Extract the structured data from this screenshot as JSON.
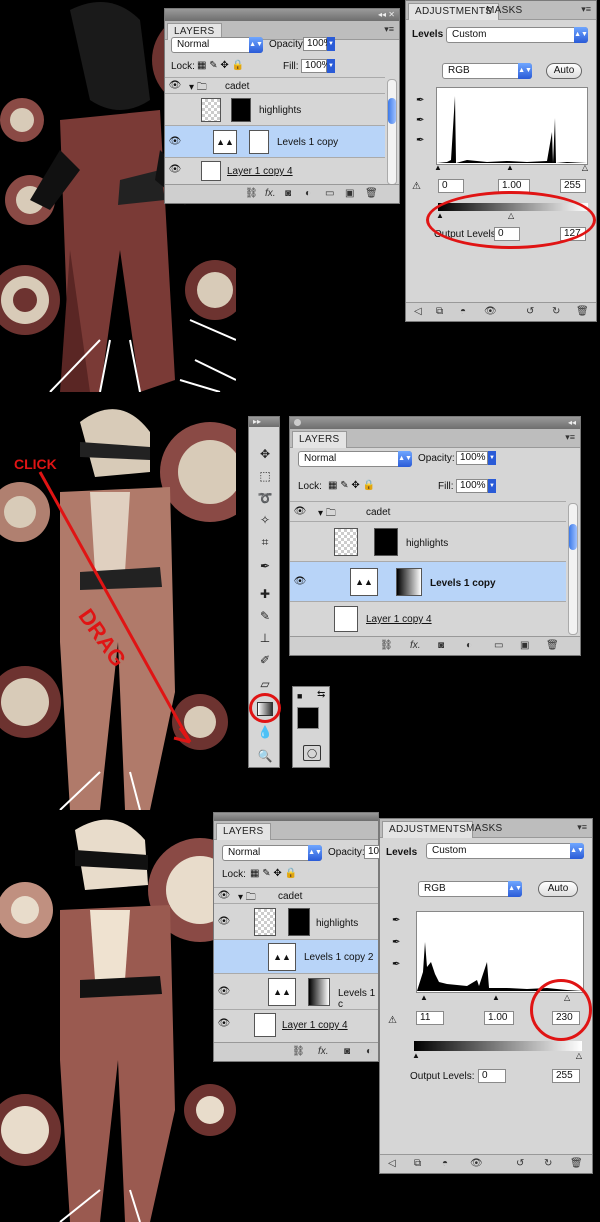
{
  "panel1": {
    "layers": {
      "tab": "LAYERS",
      "blend_mode": "Normal",
      "opacity_label": "Opacity:",
      "opacity": "100%",
      "lock_label": "Lock:",
      "fill_label": "Fill:",
      "fill": "100%",
      "items": [
        {
          "name": "cadet"
        },
        {
          "name": "highlights"
        },
        {
          "name": "Levels 1 copy"
        },
        {
          "name": "Layer 1 copy 4"
        }
      ]
    },
    "adjustments": {
      "tab1": "ADJUSTMENTS",
      "tab2": "MASKS",
      "title": "Levels",
      "preset": "Custom",
      "channel": "RGB",
      "auto": "Auto",
      "input_black": "0",
      "input_gamma": "1.00",
      "input_white": "255",
      "output_label": "Output Levels:",
      "output_black": "0",
      "output_white": "127"
    }
  },
  "panel2": {
    "annotations": {
      "click": "CLICK",
      "drag": "DRAG"
    },
    "layers": {
      "tab": "LAYERS",
      "blend_mode": "Normal",
      "opacity_label": "Opacity:",
      "opacity": "100%",
      "lock_label": "Lock:",
      "fill_label": "Fill:",
      "fill": "100%",
      "items": [
        {
          "name": "cadet"
        },
        {
          "name": "highlights"
        },
        {
          "name": "Levels 1 copy"
        },
        {
          "name": "Layer 1 copy 4"
        }
      ]
    }
  },
  "panel3": {
    "layers": {
      "tab": "LAYERS",
      "blend_mode": "Normal",
      "opacity_label": "Opacity:",
      "opacity": "10",
      "lock_label": "Lock:",
      "items": [
        {
          "name": "cadet"
        },
        {
          "name": "highlights"
        },
        {
          "name": "Levels 1 copy 2"
        },
        {
          "name": "Levels 1 c"
        },
        {
          "name": "Layer 1 copy 4"
        }
      ]
    },
    "adjustments": {
      "tab1": "ADJUSTMENTS",
      "tab2": "MASKS",
      "title": "Levels",
      "preset": "Custom",
      "channel": "RGB",
      "auto": "Auto",
      "input_black": "11",
      "input_gamma": "1.00",
      "input_white": "230",
      "output_label": "Output Levels:",
      "output_black": "0",
      "output_white": "255"
    }
  },
  "colors": {
    "annotation_red": "#e01414",
    "selection_blue": "#b8d4f8",
    "artwork_maroon": "#7a3a36"
  }
}
